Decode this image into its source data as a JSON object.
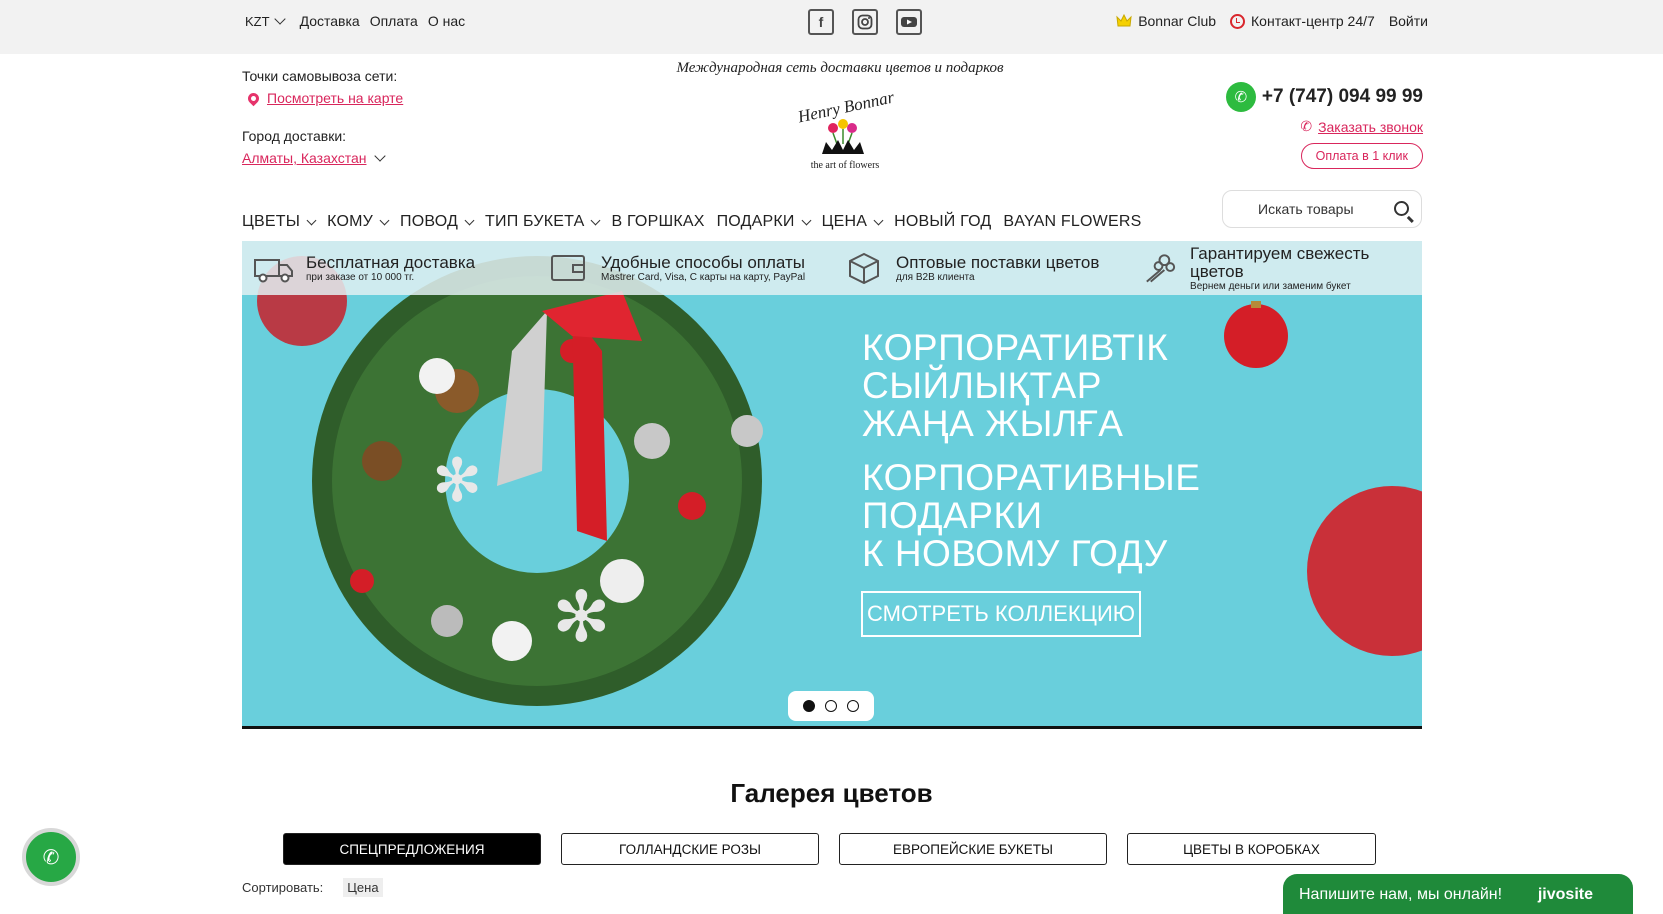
{
  "topbar": {
    "currency": "KZT",
    "links": [
      "Доставка",
      "Оплата",
      "О нас"
    ],
    "club": "Bonnar Club",
    "contact": "Контакт-центр 24/7",
    "login": "Войти"
  },
  "header": {
    "pickup_label": "Точки самовывоза сети:",
    "map_link": "Посмотреть на карте",
    "city_label": "Город доставки:",
    "city_value": "Алматы, Казахстан",
    "tagline": "Международная сеть доставки цветов и подарков",
    "logo_text": "Henry Bonnar",
    "logo_sub": "the art of flowers",
    "phone": "+7 (747) 094 99 99",
    "callback": "Заказать звонок",
    "one_click": "Оплата в 1 клик"
  },
  "nav": {
    "items": [
      {
        "label": "ЦВЕТЫ",
        "dropdown": true
      },
      {
        "label": "КОМУ",
        "dropdown": true
      },
      {
        "label": "ПОВОД",
        "dropdown": true
      },
      {
        "label": "ТИП БУКЕТА",
        "dropdown": true
      },
      {
        "label": "В ГОРШКАХ",
        "dropdown": false
      },
      {
        "label": "ПОДАРКИ",
        "dropdown": true
      },
      {
        "label": "ЦЕНА",
        "dropdown": true
      },
      {
        "label": "НОВЫЙ ГОД",
        "dropdown": false
      },
      {
        "label": "BAYAN FLOWERS",
        "dropdown": false
      }
    ],
    "search_placeholder": "Искать товары"
  },
  "features": [
    {
      "title": "Бесплатная доставка",
      "sub": "при заказе от 10 000 тг.",
      "icon": "truck-icon"
    },
    {
      "title": "Удобные способы оплаты",
      "sub": "Mastrer Card, Visa, С карты на карту, PayPal",
      "icon": "wallet-icon"
    },
    {
      "title": "Оптовые поставки цветов",
      "sub": "для B2B клиента",
      "icon": "box-icon"
    },
    {
      "title": "Гарантируем свежесть цветов",
      "sub": "Вернем деньги или заменим букет",
      "icon": "bouquet-icon"
    }
  ],
  "slide": {
    "kz_lines": [
      "КОРПОРАТИВТІК",
      "СЫЙЛЫҚТАР",
      "ЖАҢА ЖЫЛҒА"
    ],
    "ru_lines": [
      "КОРПОРАТИВНЫЕ",
      "ПОДАРКИ",
      "К НОВОМУ ГОДУ"
    ],
    "button": "СМОТРЕТЬ КОЛЛЕКЦИЮ",
    "dots": 3,
    "active_dot": 0
  },
  "gallery": {
    "title": "Галерея цветов",
    "tabs": [
      {
        "label": "СПЕЦПРЕДЛОЖЕНИЯ",
        "active": true
      },
      {
        "label": "ГОЛЛАНДСКИЕ РОЗЫ",
        "active": false
      },
      {
        "label": "ЕВРОПЕЙСКИЕ БУКЕТЫ",
        "active": false
      },
      {
        "label": "ЦВЕТЫ В КОРОБКАХ",
        "active": false
      }
    ],
    "sort_label": "Сортировать:",
    "sort_value": "Цена"
  },
  "chat": {
    "text": "Напишите нам, мы онлайн!",
    "brand": "jivosite"
  },
  "colors": {
    "accent_pink": "#d9265c",
    "banner_bg": "#69cfdc",
    "whatsapp": "#2dbb3f",
    "chat_bg": "#1f8a3a"
  }
}
